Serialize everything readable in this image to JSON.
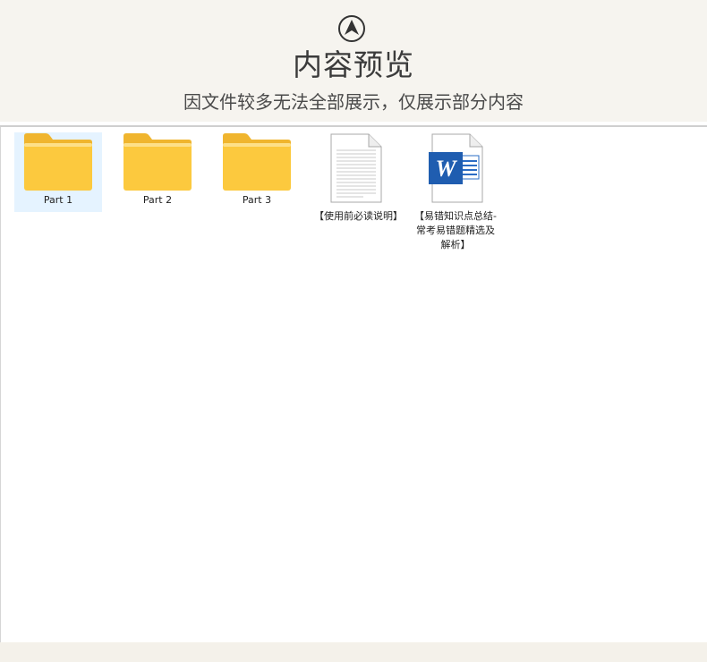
{
  "header": {
    "title": "内容预览",
    "subtitle": "因文件较多无法全部展示，仅展示部分内容"
  },
  "items": [
    {
      "label": "Part 1",
      "type": "folder",
      "selected": true
    },
    {
      "label": "Part 2",
      "type": "folder"
    },
    {
      "label": "Part 3",
      "type": "folder"
    },
    {
      "label": "【使用前必读说明】",
      "type": "text-document"
    },
    {
      "label": "【易错知识点总结-常考易错题精选及解析】",
      "type": "word-document"
    }
  ],
  "colors": {
    "folder": "#fbc841",
    "folder_back": "#f0b52e",
    "selection": "#e5f3ff",
    "word_blue": "#1f5db0"
  }
}
